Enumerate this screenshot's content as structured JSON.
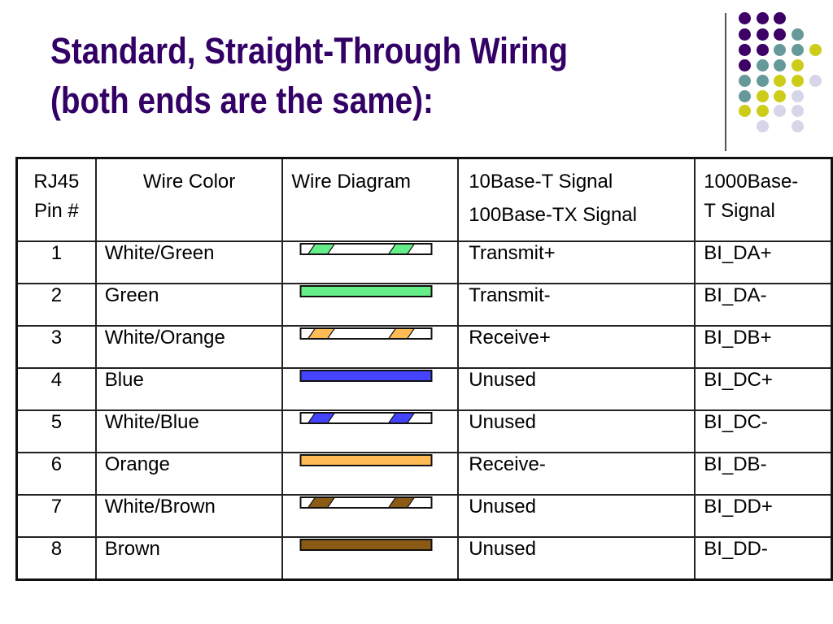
{
  "title": {
    "line1": "Standard, Straight-Through Wiring",
    "line2": "(both ends are the same):"
  },
  "theme": {
    "title_color": "#330066",
    "dot_colors": {
      "purple": "#3d0066",
      "teal": "#669999",
      "yellow": "#cccc19",
      "lavender": "#d6d6e8"
    }
  },
  "decoration": {
    "dot_grid": [
      [
        "purple",
        "purple",
        "purple",
        null,
        null
      ],
      [
        "purple",
        "purple",
        "purple",
        "teal",
        null
      ],
      [
        "purple",
        "purple",
        "teal",
        "teal",
        "yellow"
      ],
      [
        "purple",
        "teal",
        "teal",
        "yellow",
        null
      ],
      [
        "teal",
        "teal",
        "yellow",
        "yellow",
        "lavender"
      ],
      [
        "teal",
        "yellow",
        "yellow",
        "lavender",
        null
      ],
      [
        "yellow",
        "yellow",
        "lavender",
        "lavender",
        null
      ],
      [
        null,
        "lavender",
        null,
        "lavender",
        null
      ]
    ]
  },
  "table": {
    "headers": {
      "pin_line1": "RJ45",
      "pin_line2": "Pin #",
      "color": "Wire Color",
      "diagram": "Wire Diagram",
      "signal_10_100_line1": "10Base-T Signal",
      "signal_10_100_line2": "100Base-TX Signal",
      "signal_1000_line1": "1000Base-",
      "signal_1000_line2": "T Signal"
    },
    "rows": [
      {
        "pin": "1",
        "color": "White/Green",
        "wire_color": "#66ee88",
        "striped": true,
        "signal_10_100": "Transmit+",
        "signal_1000": "BI_DA+"
      },
      {
        "pin": "2",
        "color": "Green",
        "wire_color": "#66ee88",
        "striped": false,
        "signal_10_100": "Transmit-",
        "signal_1000": "BI_DA-"
      },
      {
        "pin": "3",
        "color": "White/Orange",
        "wire_color": "#ffbb55",
        "striped": true,
        "signal_10_100": "Receive+",
        "signal_1000": "BI_DB+"
      },
      {
        "pin": "4",
        "color": "Blue",
        "wire_color": "#4444ff",
        "striped": false,
        "signal_10_100": "Unused",
        "signal_1000": "BI_DC+"
      },
      {
        "pin": "5",
        "color": "White/Blue",
        "wire_color": "#4444ff",
        "striped": true,
        "signal_10_100": "Unused",
        "signal_1000": "BI_DC-"
      },
      {
        "pin": "6",
        "color": "Orange",
        "wire_color": "#ffbb55",
        "striped": false,
        "signal_10_100": "Receive-",
        "signal_1000": "BI_DB-"
      },
      {
        "pin": "7",
        "color": "White/Brown",
        "wire_color": "#8b5a14",
        "striped": true,
        "signal_10_100": "Unused",
        "signal_1000": "BI_DD+"
      },
      {
        "pin": "8",
        "color": "Brown",
        "wire_color": "#8b5a14",
        "striped": false,
        "signal_10_100": "Unused",
        "signal_1000": "BI_DD-"
      }
    ]
  }
}
